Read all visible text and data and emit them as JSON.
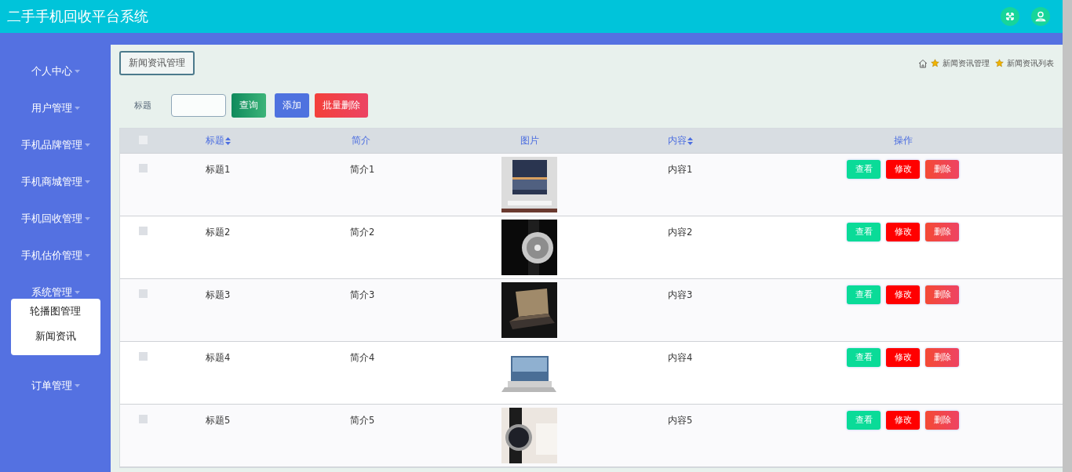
{
  "header": {
    "title": "二手手机回收平台系统"
  },
  "sidebar": {
    "items": [
      {
        "label": "个人中心"
      },
      {
        "label": "用户管理"
      },
      {
        "label": "手机品牌管理"
      },
      {
        "label": "手机商城管理"
      },
      {
        "label": "手机回收管理"
      },
      {
        "label": "手机估价管理"
      },
      {
        "label": "系统管理",
        "children": [
          {
            "label": "轮播图管理"
          },
          {
            "label": "新闻资讯"
          }
        ]
      },
      {
        "label": "订单管理"
      }
    ]
  },
  "page_tab": "新闻资讯管理",
  "breadcrumb": [
    "新闻资讯管理",
    "新闻资讯列表"
  ],
  "search": {
    "label": "标题",
    "buttons": [
      {
        "label": "查询",
        "kind": "search"
      },
      {
        "label": "添加",
        "kind": "add"
      },
      {
        "label": "批量删除",
        "kind": "delete"
      }
    ]
  },
  "table": {
    "select_all_checked": false,
    "columns": [
      {
        "label": "标题",
        "sortable": true
      },
      {
        "label": "简介",
        "sortable": false
      },
      {
        "label": "图片",
        "sortable": false
      },
      {
        "label": "内容",
        "sortable": true
      },
      {
        "label": "操作",
        "sortable": false
      }
    ],
    "rows": [
      {
        "checked": false,
        "title": "标题1",
        "summary": "简介1",
        "content": "内容1",
        "actions": [
          "查看",
          "修改",
          "删除"
        ]
      },
      {
        "checked": false,
        "title": "标题2",
        "summary": "简介2",
        "content": "内容2",
        "actions": [
          "查看",
          "修改",
          "删除"
        ]
      },
      {
        "checked": false,
        "title": "标题3",
        "summary": "简介3",
        "content": "内容3",
        "actions": [
          "查看",
          "修改",
          "删除"
        ]
      },
      {
        "checked": false,
        "title": "标题4",
        "summary": "简介4",
        "content": "内容4",
        "actions": [
          "查看",
          "修改",
          "删除"
        ]
      },
      {
        "checked": false,
        "title": "标题5",
        "summary": "简介5",
        "content": "内容5",
        "actions": [
          "查看",
          "修改",
          "删除"
        ]
      }
    ]
  }
}
